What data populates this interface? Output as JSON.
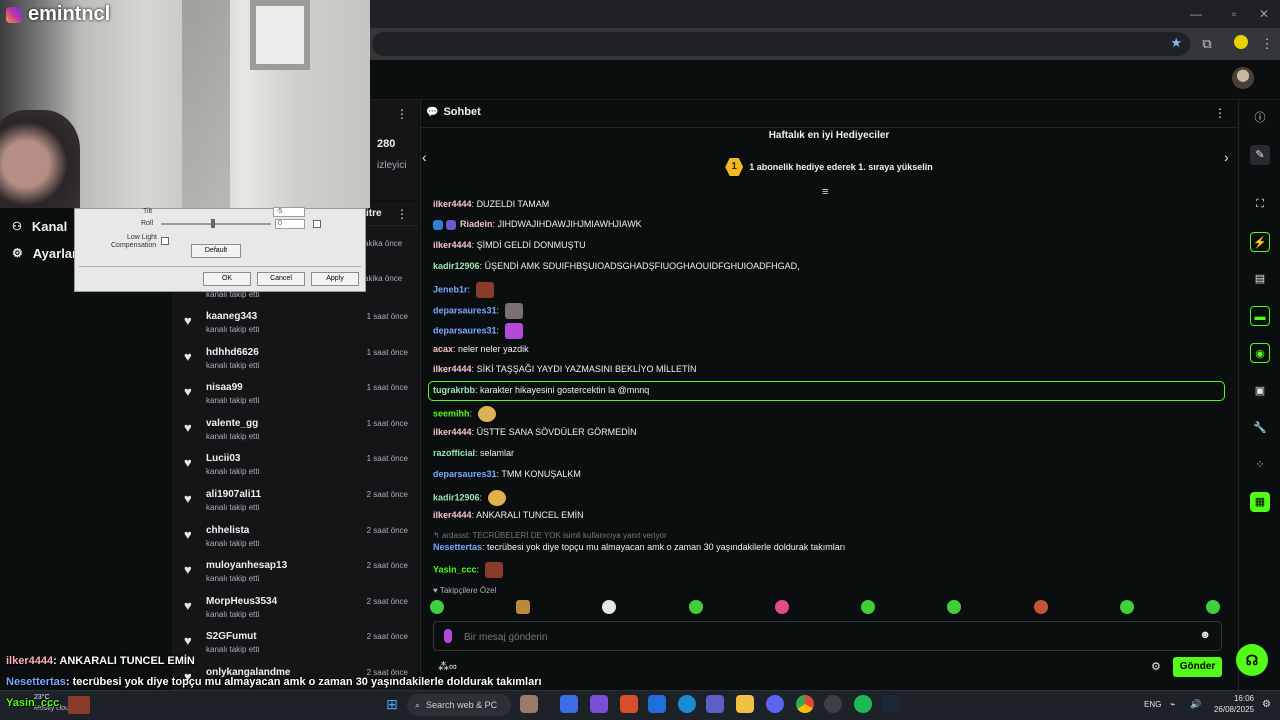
{
  "browser": {
    "tab_area_icons": [
      "minimize-icon",
      "restore-icon",
      "close-icon"
    ]
  },
  "stream": {
    "channel": "emintncl",
    "viewers": "280",
    "viewers_label": "izleyici",
    "feed_header_suffix": "itre",
    "nav": [
      {
        "label": "Kanal",
        "icon": "channel-icon"
      },
      {
        "label": "Ayarlar",
        "icon": "gear-icon"
      }
    ]
  },
  "dialog": {
    "label_tilt": "Tilt",
    "label_roll": "Roll",
    "label_lowlight": "Low Light",
    "label_comp": "Compensation",
    "tilt_value": "-5",
    "roll_value": "0",
    "default_btn": "Default",
    "ok_btn": "OK",
    "cancel_btn": "Cancel",
    "apply_btn": "Apply"
  },
  "feed": {
    "partial_rows": [
      {
        "time": "akika önce"
      },
      {
        "time": "akika önce",
        "desc": "kanalı takip etti"
      }
    ],
    "rows": [
      {
        "name": "kaaneg343",
        "desc": "kanalı takip etti",
        "time": "1 saat önce"
      },
      {
        "name": "hdhhd6626",
        "desc": "kanalı takip etti",
        "time": "1 saat önce"
      },
      {
        "name": "nisaa99",
        "desc": "kanalı takip etti",
        "time": "1 saat önce"
      },
      {
        "name": "valente_gg",
        "desc": "kanalı takip etti",
        "time": "1 saat önce"
      },
      {
        "name": "Lucii03",
        "desc": "kanalı takip etti",
        "time": "1 saat önce"
      },
      {
        "name": "ali1907ali11",
        "desc": "kanalı takip etti",
        "time": "2 saat önce"
      },
      {
        "name": "chhelista",
        "desc": "kanalı takip etti",
        "time": "2 saat önce"
      },
      {
        "name": "muloyanhesap13",
        "desc": "kanalı takip etti",
        "time": "2 saat önce"
      },
      {
        "name": "MorpHeus3534",
        "desc": "kanalı takip etti",
        "time": "2 saat önce"
      },
      {
        "name": "S2GFumut",
        "desc": "kanalı takip etti",
        "time": "2 saat önce"
      },
      {
        "name": "onlykangalandme",
        "desc": "",
        "time": "2 saat önce"
      }
    ]
  },
  "chat": {
    "title": "Sohbet",
    "gifters_title": "Haftalık en iyi Hediyeciler",
    "gifters_rank": "1",
    "gifters_cta": "1 abonelik hediye ederek 1. sıraya yükselin",
    "messages": [
      {
        "user": "ilker4444",
        "color": "#f5c2c7",
        "text": "DUZELDI TAMAM"
      },
      {
        "user": "Riadein",
        "color": "#f5c2c7",
        "text": "JIHDWAJIHDAWJIHJMIAWHJIAWK"
      },
      {
        "user": "ilker4444",
        "color": "#f5c2c7",
        "text": "ŞİMDİ GELDİ DONMUŞTU"
      },
      {
        "user": "kadir12906",
        "color": "#9ae6b4",
        "text": "ÜŞENDİ AMK SDUIFHBŞUIOADSGHADŞFIUOGHAOUIDFGHUIOADFHGAD,"
      },
      {
        "user": "Jeneb1r",
        "color": "#7aa7ff",
        "text": ""
      },
      {
        "user": "deparsaures31",
        "color": "#7aa7ff",
        "text": ""
      },
      {
        "user": "deparsaures31",
        "color": "#7aa7ff",
        "text": ""
      },
      {
        "user": "acax",
        "color": "#f5c2c7",
        "text": "neler neler yazdik"
      },
      {
        "user": "ilker4444",
        "color": "#f5c2c7",
        "text": "SİKİ TAŞŞAĞI YAYDI YAZMASINI BEKLİYO MİLLETİN"
      },
      {
        "user": "tugrakrbb",
        "color": "#9ae6b4",
        "text": "karakter hikayesini gostercektin la @mnnq"
      },
      {
        "user": "seemihh",
        "color": "#53fc18",
        "text": ""
      },
      {
        "user": "ilker4444",
        "color": "#f5c2c7",
        "text": "ÜSTTE SANA SÖVDÜLER GÖRMEDİN"
      },
      {
        "user": "razofficial",
        "color": "#9ae6b4",
        "text": "selamlar"
      },
      {
        "user": "deparsaures31",
        "color": "#7aa7ff",
        "text": "TMM KONUŞALKM"
      },
      {
        "user": "kadir12906",
        "color": "#9ae6b4",
        "text": ""
      },
      {
        "user": "ilker4444",
        "color": "#f5c2c7",
        "text": "ANKARALI TUNCEL EMİN"
      }
    ],
    "reply_note": "ardasst: TECRÜBELERİ DE YOK isimli kullanıcıya yanıt veriyor",
    "reply_user": "Nesettertas",
    "reply_text": "tecrübesi yok diye topçu mu almayacan amk o zaman 30 yaşındakilerle doldurak takımları",
    "last_user": "Yasin_ccc",
    "followers_only": "Takipçilere Özel",
    "input_placeholder": "Bir mesaj gönderin",
    "send_label": "Gönder"
  },
  "overlay": {
    "line1_user": "ilker4444",
    "line1_text": ": ANKARALI TUNCEL EMİN",
    "line2_user": "Nesettertas",
    "line2_text": ": tecrübesi yok diye topçu mu almayacan amk o zaman 30 yaşındakilerle doldurak takımları",
    "line3_user": "Yasin_ccc"
  },
  "taskbar": {
    "weather_temp": "23°C",
    "weather_desc": "Mostly clou",
    "search_label": "Search web & PC",
    "lang": "ENG",
    "time": "16:06",
    "date": "26/08/2025"
  },
  "colors": {
    "accent": "#53fc18",
    "bg": "#0b0e0f",
    "panel": "#141517"
  }
}
